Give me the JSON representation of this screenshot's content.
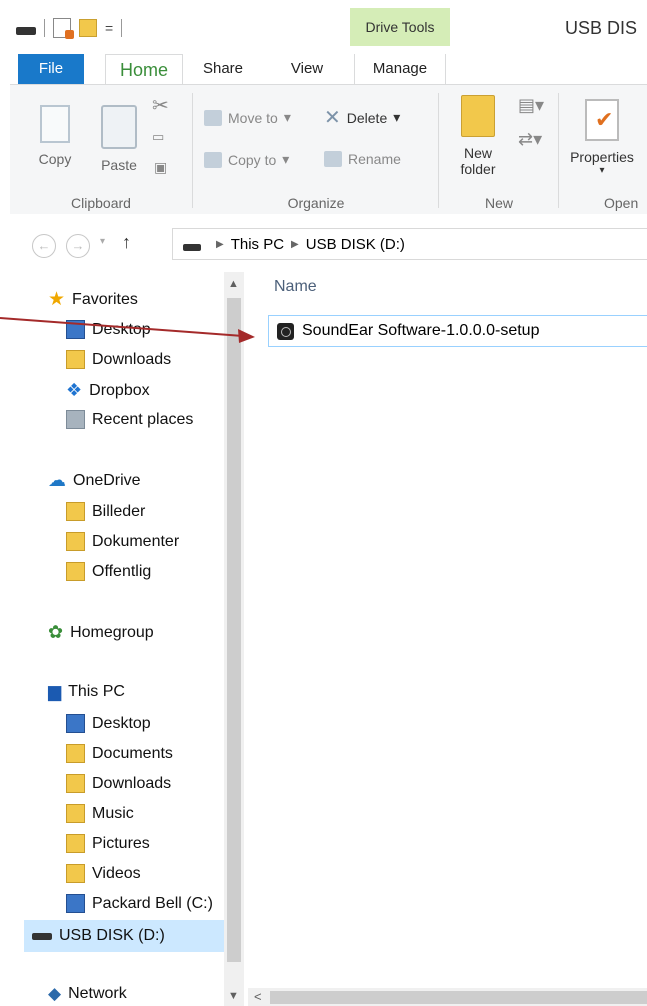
{
  "window": {
    "title": "USB DIS",
    "contextual_tab": "Drive Tools"
  },
  "tabs": {
    "file": "File",
    "home": "Home",
    "share": "Share",
    "view": "View",
    "manage": "Manage"
  },
  "ribbon": {
    "clipboard": {
      "copy": "Copy",
      "paste": "Paste",
      "group": "Clipboard"
    },
    "organize": {
      "move_to": "Move to",
      "copy_to": "Copy to",
      "delete": "Delete",
      "rename": "Rename",
      "group": "Organize"
    },
    "new": {
      "new_folder_line1": "New",
      "new_folder_line2": "folder",
      "group": "New"
    },
    "open": {
      "properties": "Properties",
      "group": "Open"
    }
  },
  "address": {
    "crumbs": [
      "This PC",
      "USB DISK (D:)"
    ]
  },
  "nav": {
    "favorites": "Favorites",
    "fav_items": [
      "Desktop",
      "Downloads",
      "Dropbox",
      "Recent places"
    ],
    "onedrive": "OneDrive",
    "onedrive_items": [
      "Billeder",
      "Dokumenter",
      "Offentlig"
    ],
    "homegroup": "Homegroup",
    "thispc": "This PC",
    "pc_items": [
      "Desktop",
      "Documents",
      "Downloads",
      "Music",
      "Pictures",
      "Videos",
      "Packard Bell (C:)",
      "USB DISK (D:)"
    ],
    "network": "Network"
  },
  "content": {
    "column_name": "Name",
    "files": [
      "SoundEar Software-1.0.0.0-setup"
    ]
  },
  "colors": {
    "file_tab": "#1979ca",
    "drive_tools_bg": "#d5edb7",
    "selection": "#cce8ff",
    "annotation_arrow": "#a42a2a"
  }
}
